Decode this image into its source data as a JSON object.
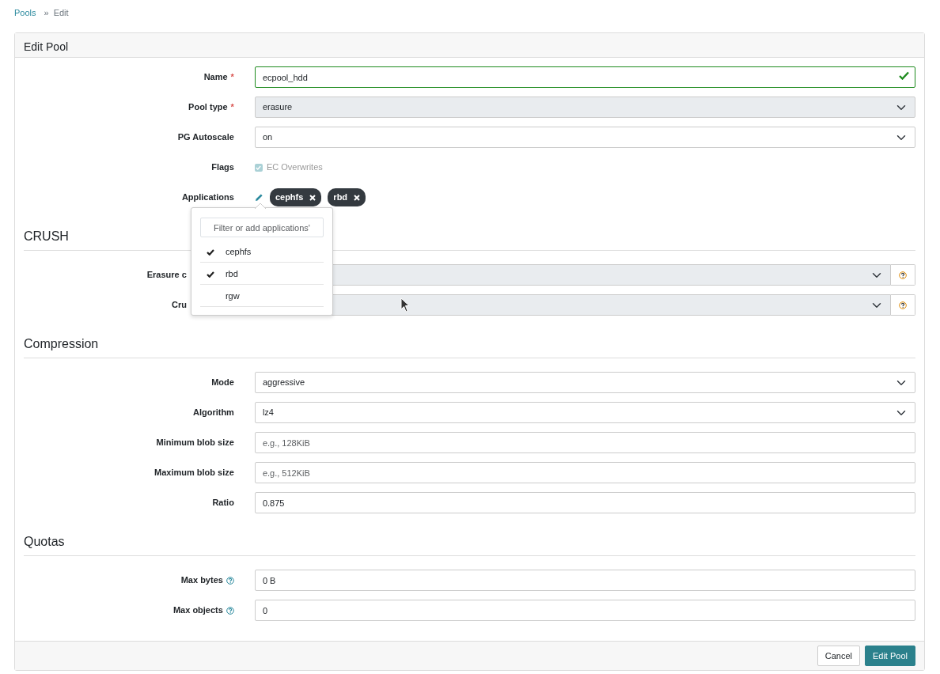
{
  "breadcrumb": [
    {
      "label": "Pools",
      "link": true
    },
    {
      "separator": "»",
      "label": "Edit",
      "link": false
    }
  ],
  "form": {
    "title": "Edit Pool",
    "sections": [
      {
        "fields": [
          {
            "kind": "text",
            "label": "Name",
            "required_mark": "*",
            "value": "ecpool_hdd",
            "valid": true
          },
          {
            "kind": "select",
            "label": "Pool type",
            "required_mark": "*",
            "value": "erasure",
            "disabled": true
          },
          {
            "kind": "select",
            "label": "PG Autoscale",
            "value": "on",
            "disabled": false
          },
          {
            "kind": "checkbox",
            "label": "Flags",
            "option": "EC Overwrites",
            "checked": true,
            "disabled": true
          },
          {
            "kind": "applications",
            "label": "Applications",
            "tags": [
              "cephfs",
              "rbd"
            ],
            "popover": {
              "placeholder": "Filter or add applications'",
              "options": [
                {
                  "label": "cephfs",
                  "checked": true
                },
                {
                  "label": "rbd",
                  "checked": true
                },
                {
                  "label": "rgw",
                  "checked": false
                }
              ]
            }
          }
        ]
      },
      {
        "heading": "CRUSH",
        "fields": [
          {
            "kind": "select",
            "label": "Erasure c",
            "disabled": true,
            "help": true
          },
          {
            "kind": "select",
            "label": "Cru",
            "disabled": true,
            "help": true
          }
        ]
      },
      {
        "heading": "Compression",
        "fields": [
          {
            "kind": "select",
            "label": "Mode",
            "value": "aggressive",
            "disabled": false
          },
          {
            "kind": "select",
            "label": "Algorithm",
            "value": "lz4",
            "disabled": false
          },
          {
            "kind": "text",
            "label": "Minimum blob size",
            "placeholder": "e.g., 128KiB"
          },
          {
            "kind": "text",
            "label": "Maximum blob size",
            "placeholder": "e.g., 512KiB"
          },
          {
            "kind": "text",
            "label": "Ratio",
            "value": "0.875"
          }
        ]
      },
      {
        "heading": "Quotas",
        "fields": [
          {
            "kind": "text",
            "label": "Max bytes",
            "value": "0 B",
            "help": true
          },
          {
            "kind": "text",
            "label": "Max objects",
            "value": "0",
            "help": true
          }
        ]
      }
    ],
    "buttons": [
      {
        "label": "Cancel",
        "primary": false
      },
      {
        "label": "Edit Pool",
        "primary": true
      }
    ]
  }
}
